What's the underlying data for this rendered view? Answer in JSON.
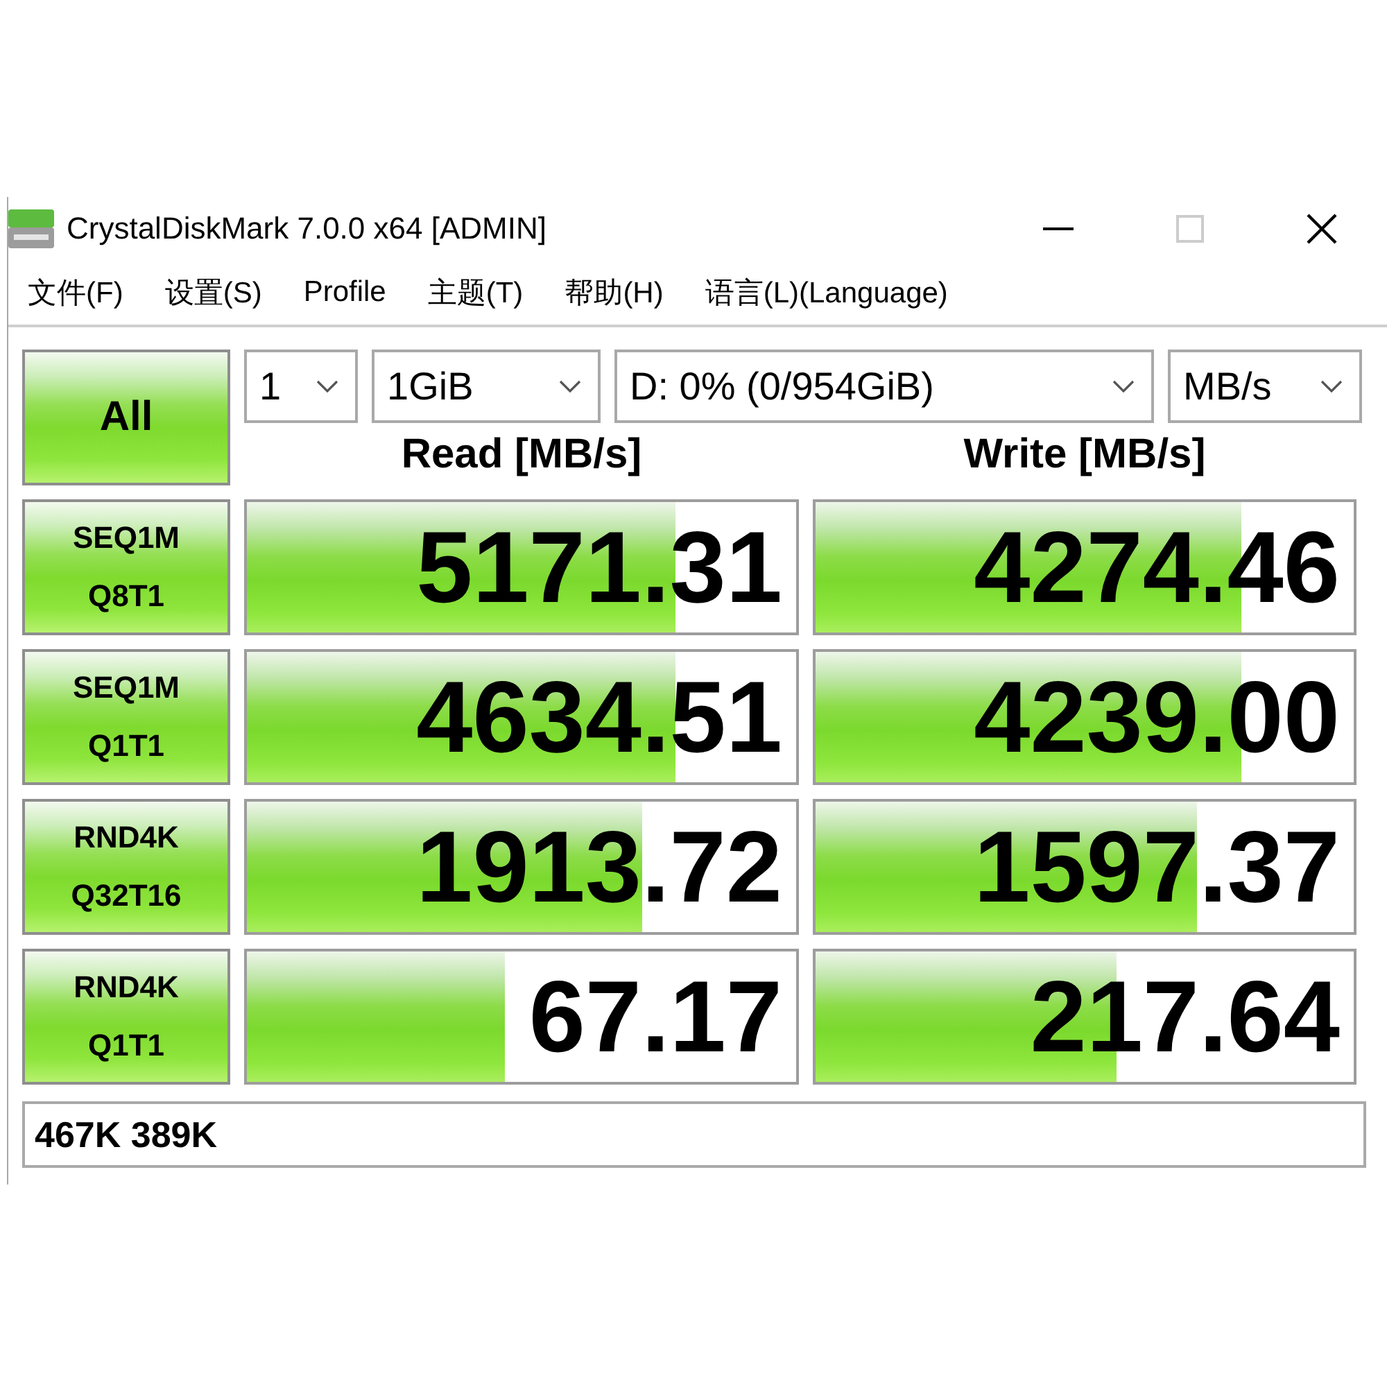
{
  "window": {
    "title": "CrystalDiskMark 7.0.0 x64 [ADMIN]",
    "controls": [
      {
        "kind": "minimize",
        "disabled": false
      },
      {
        "kind": "maximize",
        "disabled": true
      },
      {
        "kind": "close",
        "disabled": false
      }
    ]
  },
  "menu": [
    "文件(F)",
    "设置(S)",
    "Profile",
    "主题(T)",
    "帮助(H)",
    "语言(L)(Language)"
  ],
  "all_button": {
    "label": "All"
  },
  "selectors": [
    {
      "value": "1"
    },
    {
      "value": "1GiB"
    },
    {
      "value": "D: 0% (0/954GiB)"
    },
    {
      "value": "MB/s"
    }
  ],
  "columns": [
    "Read [MB/s]",
    "Write [MB/s]"
  ],
  "tests": [
    {
      "name": "SEQ1M",
      "params": "Q8T1",
      "results": [
        {
          "value": "5171.31",
          "level": 0.78
        },
        {
          "value": "4274.46",
          "level": 0.79
        }
      ]
    },
    {
      "name": "SEQ1M",
      "params": "Q1T1",
      "results": [
        {
          "value": "4634.51",
          "level": 0.78
        },
        {
          "value": "4239.00",
          "level": 0.79
        }
      ]
    },
    {
      "name": "RND4K",
      "params": "Q32T16",
      "results": [
        {
          "value": "1913.72",
          "level": 0.72
        },
        {
          "value": "1597.37",
          "level": 0.71
        }
      ]
    },
    {
      "name": "RND4K",
      "params": "Q1T1",
      "results": [
        {
          "value": "67.17",
          "level": 0.47
        },
        {
          "value": "217.64",
          "level": 0.56
        }
      ]
    }
  ],
  "comment": {
    "value": "467K 389K"
  }
}
